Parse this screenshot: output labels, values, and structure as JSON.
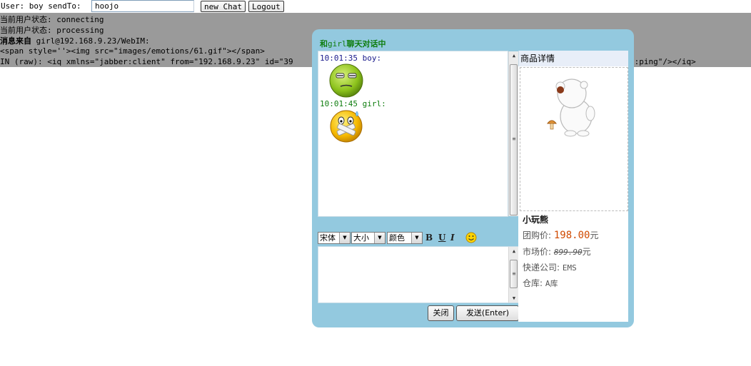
{
  "topbar": {
    "user_label": "User: boy sendTo:",
    "sendto_value": "hoojo",
    "new_chat_label": "new Chat",
    "logout_label": "Logout"
  },
  "log": {
    "status1": "当前用户状态: connecting",
    "status2": "当前用户状态: processing",
    "from_label": "消息来自",
    "from_value": "girl@192.168.9.23/WebIM:",
    "html_line": "<span style=''><img src=\"images/emotions/61.gif\"></span>",
    "raw_left": "IN (raw): <iq xmlns=\"jabber:client\" from=\"192.168.9.23\" id=\"39",
    "raw_right": "p:ping\"/></iq>"
  },
  "chat": {
    "title_prefix": "和",
    "title_user": "girl",
    "title_suffix": "聊天对话中",
    "messages": [
      {
        "header": "10:01:35 boy:",
        "color": "#1a1a8c",
        "emoticon": "annoyed-face-emoticon"
      },
      {
        "header": "10:01:45 girl:",
        "color": "#0e7d0e",
        "emoticon": "bandaged-face-emoticon"
      }
    ],
    "toolbar": {
      "font_label": "宋体",
      "size_label": "大小",
      "color_label": "颜色",
      "bold_label": "B",
      "underline_label": "U",
      "italic_label": "I",
      "emoticon_icon": "smiley-icon"
    },
    "input_value": "",
    "close_label": "关闭",
    "send_label": "发送(Enter)"
  },
  "product": {
    "header": "商品详情",
    "name": "小玩熊",
    "group_price_label": "团购价:",
    "group_price": "198.00",
    "group_price_unit": "元",
    "market_price_label": "市场价:",
    "market_price": "899.90",
    "market_price_unit": "元",
    "shipping_label": "快递公司:",
    "shipping": "EMS",
    "warehouse_label": "仓库:",
    "warehouse": "A库"
  },
  "colors": {
    "window_bg": "#93c9df",
    "log_bg": "#9a9a9a",
    "title_green": "#0e7d0e",
    "price_orange": "#d04a00"
  }
}
